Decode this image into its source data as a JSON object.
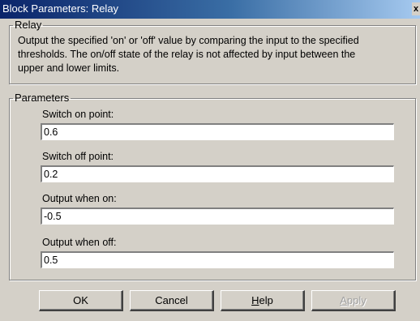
{
  "window": {
    "title": "Block Parameters: Relay",
    "close_glyph": "x"
  },
  "relay_group": {
    "legend": "Relay",
    "description_lines": [
      "Output the specified 'on' or 'off' value by comparing the input to the specified",
      "thresholds.  The on/off state of the relay is not affected by input between the",
      "upper and lower limits."
    ]
  },
  "parameters_group": {
    "legend": "Parameters",
    "fields": [
      {
        "label": "Switch on point:",
        "value": "0.6"
      },
      {
        "label": "Switch off point:",
        "value": "0.2"
      },
      {
        "label": "Output when on:",
        "value": "-0.5"
      },
      {
        "label": "Output when off:",
        "value": "0.5"
      }
    ]
  },
  "buttons": {
    "ok": "OK",
    "cancel": "Cancel",
    "help_mnemonic": "H",
    "help_rest": "elp",
    "apply_mnemonic": "A",
    "apply_rest": "pply"
  }
}
